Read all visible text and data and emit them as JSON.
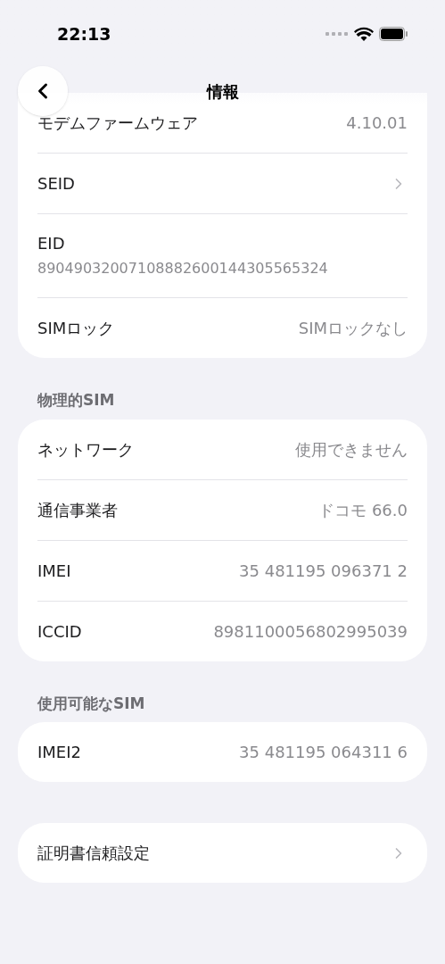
{
  "status_bar": {
    "time": "22:13"
  },
  "header": {
    "title": "情報"
  },
  "sections": [
    {
      "rows": [
        {
          "kind": "value",
          "label": "モデムファームウェア",
          "value": "4.10.01"
        },
        {
          "kind": "link",
          "label": "SEID"
        },
        {
          "kind": "stacked",
          "label": "EID",
          "value": "89049032007108882600144305565324"
        },
        {
          "kind": "value",
          "label": "SIMロック",
          "value": "SIMロックなし"
        }
      ]
    },
    {
      "title": "物理的SIM",
      "rows": [
        {
          "kind": "value",
          "label": "ネットワーク",
          "value": "使用できません"
        },
        {
          "kind": "value",
          "label": "通信事業者",
          "value": "ドコモ 66.0"
        },
        {
          "kind": "value",
          "label": "IMEI",
          "value": "35 481195 096371 2"
        },
        {
          "kind": "value",
          "label": "ICCID",
          "value": "8981100056802995039"
        }
      ]
    },
    {
      "title": "使用可能なSIM",
      "rows": [
        {
          "kind": "value",
          "label": "IMEI2",
          "value": "35 481195 064311 6"
        }
      ]
    },
    {
      "rows": [
        {
          "kind": "link",
          "label": "証明書信頼設定"
        }
      ]
    }
  ]
}
